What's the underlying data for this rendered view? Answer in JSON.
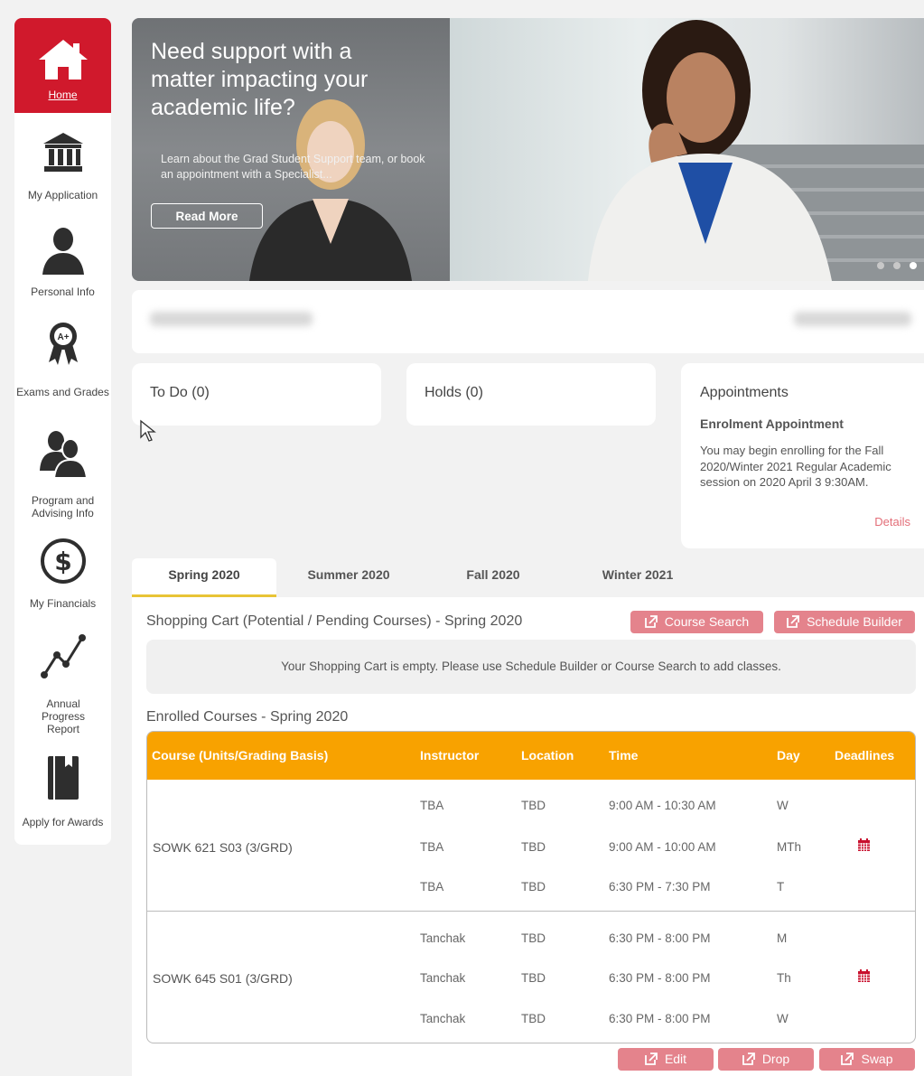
{
  "sidebar": {
    "items": [
      {
        "label": "Home",
        "icon": "home-icon"
      },
      {
        "label": "My Application",
        "icon": "institution-icon"
      },
      {
        "label": "Personal Info",
        "icon": "person-icon"
      },
      {
        "label": "Exams and Grades",
        "icon": "award-ribbon-icon"
      },
      {
        "label": "Program and Advising Info",
        "icon": "advisor-icon"
      },
      {
        "label": "My Financials",
        "icon": "dollar-icon"
      },
      {
        "label": "Annual Progress Report",
        "icon": "progress-chart-icon"
      },
      {
        "label": "Apply for Awards",
        "icon": "book-icon"
      }
    ],
    "active_color": "#d0192c"
  },
  "hero": {
    "title": "Need support with a matter impacting your academic life?",
    "subtitle": "Learn about the Grad Student Support team, or book an appointment with a Specialist...",
    "button": "Read More"
  },
  "cards": {
    "todo": "To Do (0)",
    "holds": "Holds (0)",
    "appointments": {
      "title": "Appointments",
      "heading": "Enrolment Appointment",
      "text": "You may begin enrolling for the Fall 2020/Winter 2021 Regular Academic session on 2020 April 3 9:30AM.",
      "link": "Details"
    }
  },
  "tabs": [
    "Spring 2020",
    "Summer 2020",
    "Fall 2020",
    "Winter 2021"
  ],
  "shopping_cart": {
    "title": "Shopping Cart (Potential / Pending Courses) - Spring 2020",
    "course_search": "Course Search",
    "schedule_builder": "Schedule Builder",
    "empty_message": "Your Shopping Cart is empty. Please use Schedule Builder or Course Search to add classes."
  },
  "enrolled": {
    "title": "Enrolled Courses - Spring 2020",
    "headers": [
      "Course (Units/Grading Basis)",
      "Instructor",
      "Location",
      "Time",
      "Day",
      "Deadlines"
    ],
    "courses": [
      {
        "name": "SOWK  621 S03 (3/GRD)",
        "rows": [
          {
            "instructor": "TBA",
            "location": "TBD",
            "time": "9:00 AM - 10:30 AM",
            "day": "W"
          },
          {
            "instructor": "TBA",
            "location": "TBD",
            "time": "9:00 AM - 10:00 AM",
            "day": "MTh"
          },
          {
            "instructor": "TBA",
            "location": "TBD",
            "time": "6:30 PM - 7:30 PM",
            "day": "T"
          }
        ]
      },
      {
        "name": "SOWK  645 S01 (3/GRD)",
        "rows": [
          {
            "instructor": "Tanchak",
            "location": "TBD",
            "time": "6:30 PM - 8:00 PM",
            "day": "M"
          },
          {
            "instructor": "Tanchak",
            "location": "TBD",
            "time": "6:30 PM - 8:00 PM",
            "day": "Th"
          },
          {
            "instructor": "Tanchak",
            "location": "TBD",
            "time": "6:30 PM - 8:00 PM",
            "day": "W"
          }
        ]
      }
    ],
    "header_color": "#f8a200",
    "actions": [
      "Edit",
      "Drop",
      "Swap"
    ]
  },
  "colors": {
    "button_pink": "#e4838c",
    "tab_underline": "#e8c436",
    "calendar_red": "#c8102e"
  }
}
